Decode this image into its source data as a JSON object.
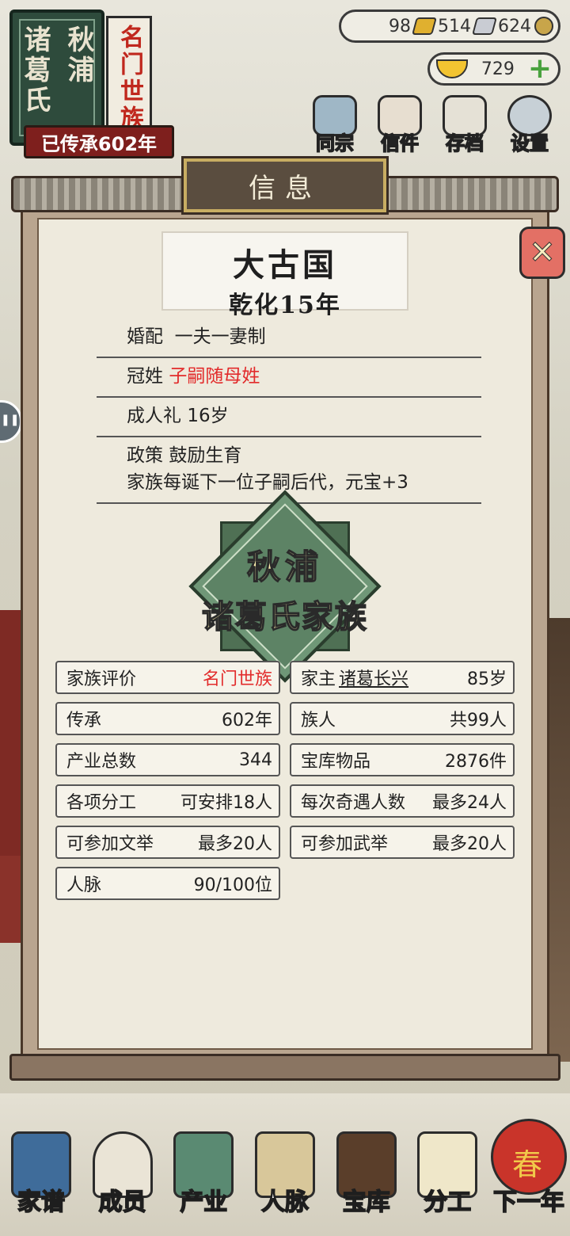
{
  "family": {
    "name_line1": "秋浦",
    "name_line2": "诸葛氏",
    "rank": "名门世族",
    "inherit": "已传承602年"
  },
  "currency": {
    "gold": "98",
    "silver": "514",
    "coin": "624",
    "ingot": "729"
  },
  "menu": [
    "同宗",
    "信件",
    "存档",
    "设置"
  ],
  "panel": {
    "title": "信息",
    "close_symbol": "✕",
    "country": "大古国",
    "year": "乾化15年"
  },
  "policies": [
    {
      "key": "婚配",
      "value": "一夫一妻制",
      "highlight": false
    },
    {
      "key": "冠姓",
      "value": "子嗣随母姓",
      "highlight": true
    },
    {
      "key": "成人礼",
      "value": "16岁",
      "highlight": false
    },
    {
      "key": "政策",
      "value": "鼓励生育",
      "desc": "家族每诞下一位子嗣后代，元宝+3",
      "highlight": false
    }
  ],
  "emblem": {
    "line1": "秋浦",
    "line2": "诸葛氏家族"
  },
  "stats": [
    {
      "label": "家族评价",
      "value": "名门世族",
      "color": "#e22b2b"
    },
    {
      "label": "家主",
      "name": "诸葛长兴",
      "value": "85岁"
    },
    {
      "label": "传承",
      "value": "602年"
    },
    {
      "label": "族人",
      "value": "共99人"
    },
    {
      "label": "产业总数",
      "value": "344"
    },
    {
      "label": "宝库物品",
      "value": "2876件"
    },
    {
      "label": "各项分工",
      "value": "可安排18人"
    },
    {
      "label": "每次奇遇人数",
      "value": "最多24人"
    },
    {
      "label": "可参加文举",
      "value": "最多20人"
    },
    {
      "label": "可参加武举",
      "value": "最多20人"
    },
    {
      "label": "人脉",
      "value": "90/100位"
    }
  ],
  "nav": [
    "家谱",
    "成员",
    "产业",
    "人脉",
    "宝库",
    "分工",
    "下一年"
  ],
  "next_year_glyph": "春",
  "colors": {
    "accent_red": "#e22b2b",
    "panel_bg": "#eeeadd",
    "emblem_green": "#5d8365"
  }
}
